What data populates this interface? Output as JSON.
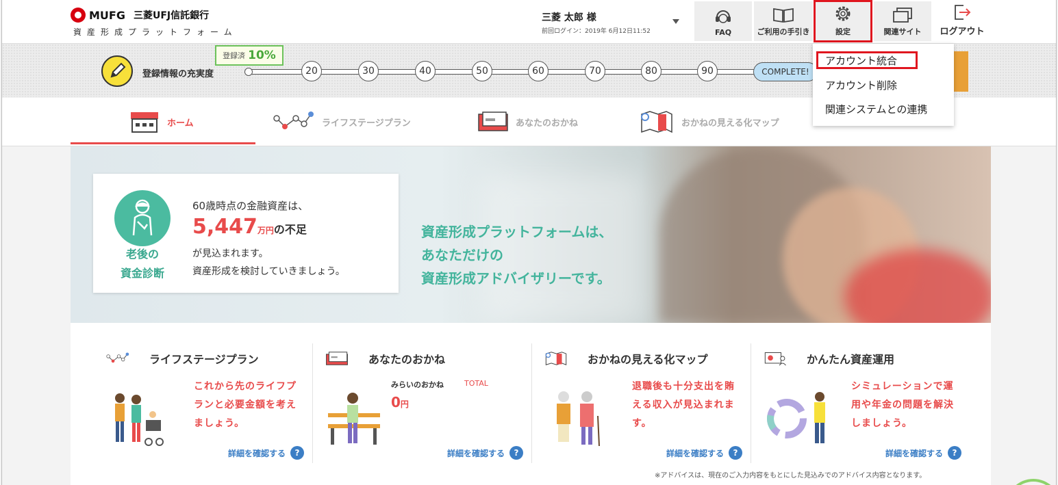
{
  "header": {
    "brand": "MUFG",
    "bank": "三菱UFJ信託銀行",
    "subtitle": "資産形成プラットフォーム",
    "user_name": "三菱 太郎 様",
    "last_login": "前回ログイン：2019年 6月12日11:52",
    "buttons": {
      "faq": "FAQ",
      "guide": "ご利用の手引き",
      "settings": "設定",
      "related": "関連サイト",
      "logout": "ログアウト"
    }
  },
  "progress": {
    "label": "登録情報の充実度",
    "badge_prefix": "登録済",
    "badge_value": "10%",
    "value_percent": 10,
    "milestones": [
      "20",
      "30",
      "40",
      "50",
      "60",
      "70",
      "80",
      "90"
    ],
    "complete": "COMPLETE!"
  },
  "nav": {
    "items": [
      {
        "label": "ホーム"
      },
      {
        "label": "ライフステージプラン"
      },
      {
        "label": "あなたのおかね"
      },
      {
        "label": "おかねの見える化マップ"
      }
    ]
  },
  "settings_menu": {
    "items": [
      {
        "label": "アカウント統合"
      },
      {
        "label": "アカウント削除"
      },
      {
        "label": "関連システムとの連携"
      }
    ]
  },
  "hero": {
    "message_lines": [
      "資産形成プラットフォームは、",
      "あなただけの",
      "資産形成アドバイザリーです。"
    ],
    "diagnosis": {
      "label_line1": "老後の",
      "label_line2": "資金診断",
      "line1": "60歳時点の金融資産は、",
      "amount": "5,447",
      "unit": "万円",
      "suffix": "の不足",
      "line3": "が見込まれます。",
      "line4": "資産形成を検討していきましょう。"
    }
  },
  "cards": [
    {
      "title": "ライフステージプラン",
      "desc": "これから先のライフプランと必要金額を考えましょう。",
      "link": "詳細を確認する"
    },
    {
      "title": "あなたのおかね",
      "mirai_label": "みらいのおかね",
      "total_label": "TOTAL",
      "value": "0",
      "unit": "円",
      "link": "詳細を確認する"
    },
    {
      "title": "おかねの見える化マップ",
      "desc": "退職後も十分支出を賄える収入が見込まれます。",
      "link": "詳細を確認する"
    },
    {
      "title": "かんたん資産運用",
      "desc": "シミュレーションで運用や年金の問題を解決しましょう。",
      "link": "詳細を確認する"
    }
  ],
  "help_icon": "?",
  "footnote": "※アドバイスは、現在のご入力内容をもとにした見込みでのアドバイス内容となります。",
  "colors": {
    "accent_red": "#e84b4b",
    "teal": "#43b49c",
    "link_blue": "#3b7ec5",
    "highlight": "#e0161f"
  }
}
